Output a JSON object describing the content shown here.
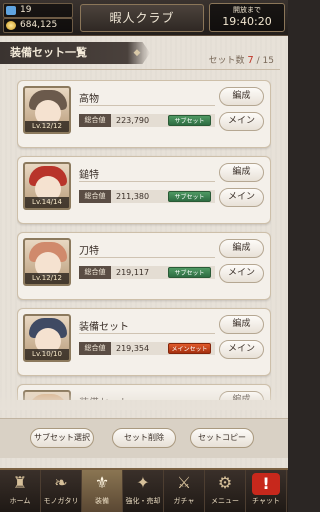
{
  "header": {
    "stamina": "19",
    "coins": "684,125",
    "title": "暇人クラブ",
    "timer_label": "開放まで",
    "timer_value": "19:40:20"
  },
  "section": {
    "title": "装備セット一覧",
    "count_label": "セット数",
    "count_current": "7",
    "count_total": "/ 15"
  },
  "card_labels": {
    "rank": "総合値",
    "edit": "編成",
    "main": "メイン"
  },
  "sets": [
    {
      "name": "高物",
      "level": "Lv.12/12",
      "value": "223,790",
      "tag": "サブセット",
      "tag_type": "sub",
      "hair": "#6b5a4c"
    },
    {
      "name": "鎚特",
      "level": "Lv.14/14",
      "value": "211,380",
      "tag": "サブセット",
      "tag_type": "sub",
      "hair": "#b8342a"
    },
    {
      "name": "刀特",
      "level": "Lv.12/12",
      "value": "219,117",
      "tag": "サブセット",
      "tag_type": "sub",
      "hair": "#d08a6c"
    },
    {
      "name": "装備セット",
      "level": "Lv.10/10",
      "value": "219,354",
      "tag": "メインセット",
      "tag_type": "main",
      "hair": "#3f4a63"
    },
    {
      "name": "装備セット",
      "level": "",
      "value": "",
      "tag": "",
      "tag_type": "sub",
      "hair": "#d9b48e"
    }
  ],
  "actions": {
    "sub_select": "サブセット選択",
    "delete": "セット削除",
    "copy": "セットコピー"
  },
  "nav": [
    {
      "label": "ホーム",
      "icon": "castle-icon",
      "glyph": "♜"
    },
    {
      "label": "モノガタリ",
      "icon": "book-icon",
      "glyph": "❧"
    },
    {
      "label": "装備",
      "icon": "equipment-icon",
      "glyph": "⚜"
    },
    {
      "label": "強化・売却",
      "icon": "enhance-icon",
      "glyph": "✦"
    },
    {
      "label": "ガチャ",
      "icon": "gacha-icon",
      "glyph": "⚔"
    },
    {
      "label": "メニュー",
      "icon": "gear-icon",
      "glyph": "⚙"
    },
    {
      "label": "チャット",
      "icon": "chat-icon",
      "glyph": "!"
    }
  ]
}
